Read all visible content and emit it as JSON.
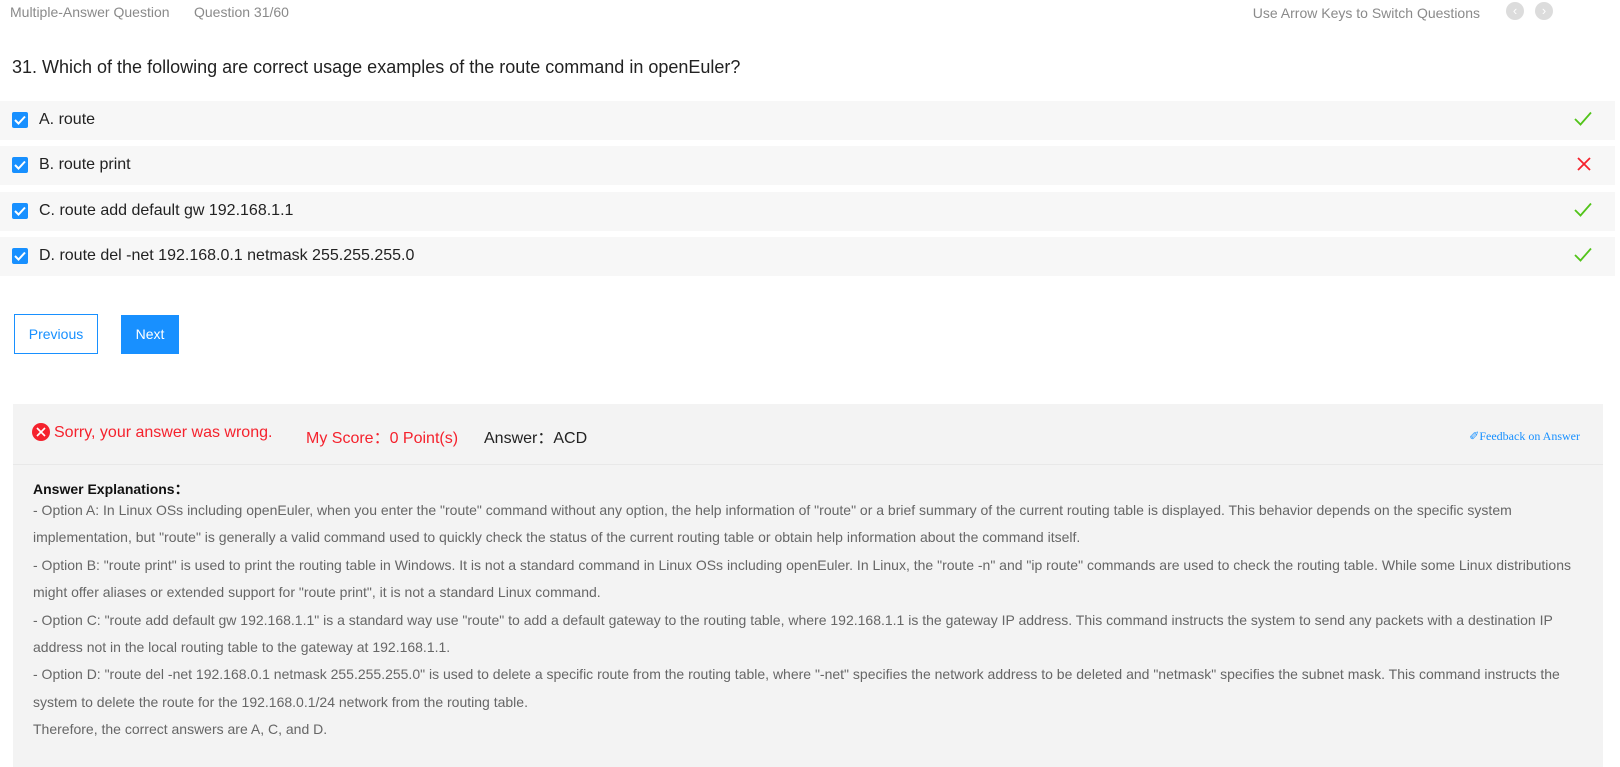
{
  "header": {
    "question_type": "Multiple-Answer Question",
    "counter": "Question 31/60",
    "hint": "Use Arrow Keys to Switch Questions",
    "prev_icon": "chevron-left-icon",
    "next_icon": "chevron-right-icon"
  },
  "question": {
    "text": "31. Which of the following are correct usage examples of the route command in openEuler?"
  },
  "options": [
    {
      "label": "A. route",
      "checked": true,
      "result": "correct"
    },
    {
      "label": "B. route print",
      "checked": true,
      "result": "wrong"
    },
    {
      "label": "C. route add default gw 192.168.1.1",
      "checked": true,
      "result": "correct"
    },
    {
      "label": "D. route del -net 192.168.0.1 netmask 255.255.255.0",
      "checked": true,
      "result": "correct"
    }
  ],
  "buttons": {
    "previous": "Previous",
    "next": "Next"
  },
  "result": {
    "message": "Sorry, your answer was wrong.",
    "score": "My Score：0 Point(s)",
    "answer": "Answer：ACD",
    "feedback": "Feedback on Answer"
  },
  "explanation": {
    "title": "Answer Explanations：",
    "lines": [
      "- Option A: In Linux OSs including openEuler, when you enter the \"route\" command without any option, the help information of \"route\" or a brief summary of the current routing table is displayed. This behavior depends on the specific system implementation, but \"route\" is generally a valid command used to quickly check the status of the current routing table or obtain help information about the command itself.",
      "- Option B: \"route print\" is used to print the routing table in Windows. It is not a standard command in Linux OSs including openEuler. In Linux, the \"route -n\" and \"ip route\" commands are used to check the routing table. While some Linux distributions might offer aliases or extended support for \"route print\", it is not a standard Linux command.",
      "- Option C: \"route add default gw 192.168.1.1\" is a standard way use \"route\" to add a default gateway to the routing table, where 192.168.1.1 is the gateway IP address. This command instructs the system to send any packets with a destination IP address not in the local routing table to the gateway at 192.168.1.1.",
      "- Option D: \"route del -net 192.168.0.1 netmask 255.255.255.0\" is used to delete a specific route from the routing table, where \"-net\" specifies the network address to be deleted and \"netmask\" specifies the subnet mask. This command instructs the system to delete the route for the 192.168.0.1/24 network from the routing table.",
      "Therefore, the correct answers are A, C, and D."
    ]
  },
  "colors": {
    "primary": "#1890ff",
    "error": "#f5222d",
    "success": "#52c41a"
  }
}
